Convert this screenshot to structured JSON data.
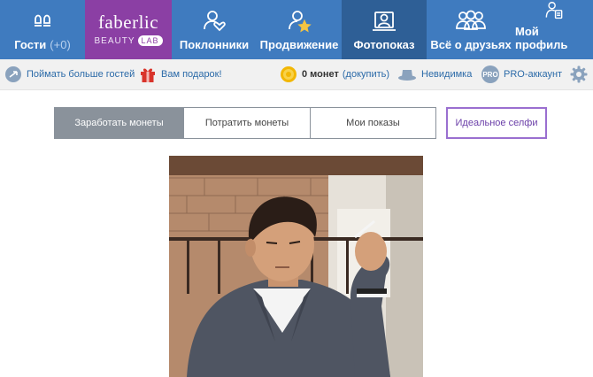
{
  "nav": {
    "guests_label": "Гости",
    "guests_count": "(+0)",
    "brand_name": "faberlic",
    "brand_sub": "BEAUTY",
    "brand_lab": "LAB",
    "fans_label": "Поклонники",
    "promo_label": "Продвижение",
    "photo_label": "Фотопоказ",
    "friends_label": "Всё о друзьях",
    "profile_label": "Мой профиль",
    "active_item": "Фотопоказ"
  },
  "subbar": {
    "more_guests": "Поймать больше гостей",
    "gift": "Вам подарок!",
    "coins_amount": "0 монет",
    "coins_topup": "(докупить)",
    "invisible": "Невидимка",
    "pro_badge": "PRO",
    "pro_account": "PRO-аккаунт"
  },
  "tabs": {
    "earn": "Заработать монеты",
    "spend": "Потратить монеты",
    "shows": "Мои показы",
    "active": "Заработать монеты"
  },
  "selfie_button": "Идеальное селфи",
  "photo": {
    "description": "Man in a grey suit and white shirt holding a cigarette, seated in front of a brick wall and window"
  },
  "colors": {
    "nav_bg": "#3f7bbf",
    "nav_active": "#2e5f96",
    "brand_bg": "#8b3fa4",
    "tab_active": "#8a929b",
    "selfie_border": "#9a6fd0",
    "link": "#2b6aa8"
  },
  "icons": [
    "guests-icon",
    "fans-icon",
    "promo-icon",
    "photoshow-icon",
    "friends-icon",
    "profile-icon",
    "share-icon",
    "gift-icon",
    "coin-icon",
    "hat-icon",
    "pro-icon",
    "gear-icon"
  ]
}
